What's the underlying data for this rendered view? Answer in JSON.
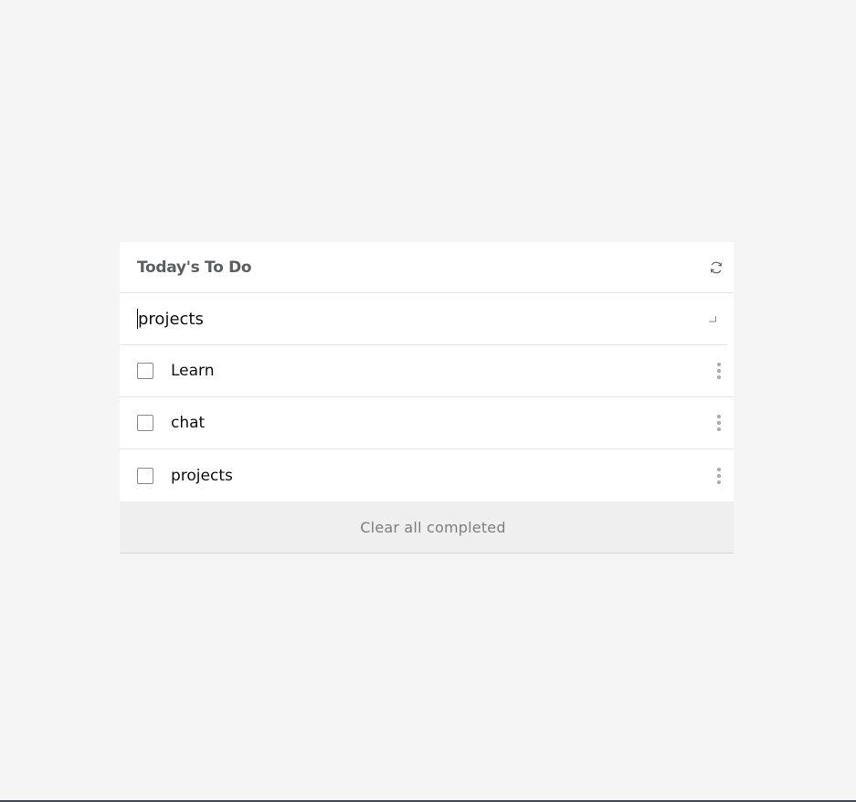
{
  "header": {
    "title": "Today's To Do",
    "refresh_icon": "refresh-icon"
  },
  "input": {
    "value": "projects",
    "enter_icon": "enter-return-icon"
  },
  "tasks": [
    {
      "label": "Learn",
      "checked": false
    },
    {
      "label": "chat",
      "checked": false
    },
    {
      "label": "projects",
      "checked": false
    }
  ],
  "footer": {
    "clear_label": "Clear all completed"
  }
}
